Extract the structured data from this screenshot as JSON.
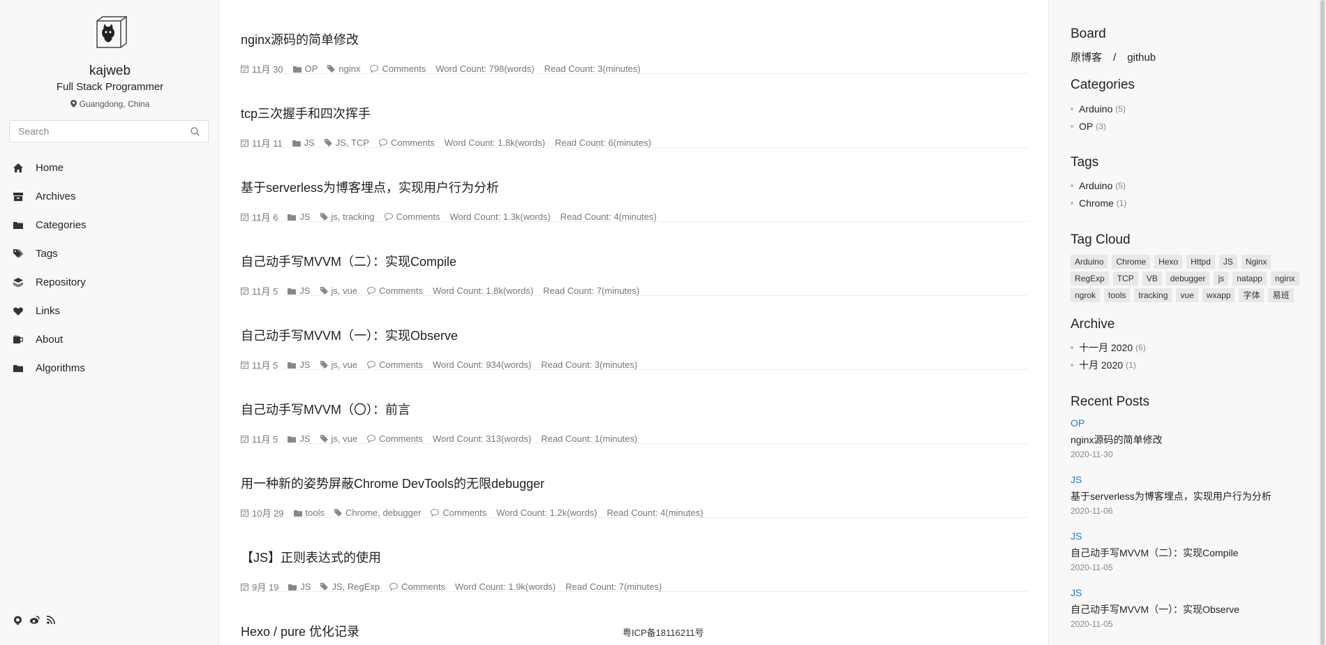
{
  "author": {
    "name": "kajweb",
    "subtitle": "Full Stack Programmer",
    "location": "Guangdong, China"
  },
  "search": {
    "placeholder": "Search"
  },
  "nav": [
    {
      "label": "Home",
      "icon": "home-icon"
    },
    {
      "label": "Archives",
      "icon": "archive-icon"
    },
    {
      "label": "Categories",
      "icon": "folder-icon"
    },
    {
      "label": "Tags",
      "icon": "tags-icon"
    },
    {
      "label": "Repository",
      "icon": "repository-icon"
    },
    {
      "label": "Links",
      "icon": "handshake-icon"
    },
    {
      "label": "About",
      "icon": "coffee-icon"
    },
    {
      "label": "Algorithms",
      "icon": "folder-icon"
    }
  ],
  "social": [
    "github-icon",
    "weibo-icon",
    "rss-icon"
  ],
  "posts": [
    {
      "title": "nginx源码的简单修改",
      "date": "11月 30",
      "category": "OP",
      "tags": "nginx",
      "comments": "Comments",
      "word_count": "Word Count: 798(words)",
      "read_count": "Read Count: 3(minutes)"
    },
    {
      "title": "tcp三次握手和四次挥手",
      "date": "11月 11",
      "category": "JS",
      "tags": "JS, TCP",
      "comments": "Comments",
      "word_count": "Word Count: 1.8k(words)",
      "read_count": "Read Count: 6(minutes)"
    },
    {
      "title": "基于serverless为博客埋点，实现用户行为分析",
      "date": "11月 6",
      "category": "JS",
      "tags": "js, tracking",
      "comments": "Comments",
      "word_count": "Word Count: 1.3k(words)",
      "read_count": "Read Count: 4(minutes)"
    },
    {
      "title": "自己动手写MVVM（二）：实现Compile",
      "date": "11月 5",
      "category": "JS",
      "tags": "js, vue",
      "comments": "Comments",
      "word_count": "Word Count: 1.8k(words)",
      "read_count": "Read Count: 7(minutes)"
    },
    {
      "title": "自己动手写MVVM（一）：实现Observe",
      "date": "11月 5",
      "category": "JS",
      "tags": "js, vue",
      "comments": "Comments",
      "word_count": "Word Count: 934(words)",
      "read_count": "Read Count: 3(minutes)"
    },
    {
      "title": "自己动手写MVVM（〇）：前言",
      "date": "11月 5",
      "category": "JS",
      "tags": "js, vue",
      "comments": "Comments",
      "word_count": "Word Count: 313(words)",
      "read_count": "Read Count: 1(minutes)"
    },
    {
      "title": "用一种新的姿势屏蔽Chrome DevTools的无限debugger",
      "date": "10月 29",
      "category": "tools",
      "tags": "Chrome, debugger",
      "comments": "Comments",
      "word_count": "Word Count: 1.2k(words)",
      "read_count": "Read Count: 4(minutes)"
    },
    {
      "title": "【JS】正则表达式的使用",
      "date": "9月 19",
      "category": "JS",
      "tags": "JS, RegExp",
      "comments": "Comments",
      "word_count": "Word Count: 1.9k(words)",
      "read_count": "Read Count: 7(minutes)"
    },
    {
      "title": "Hexo / pure 优化记录"
    }
  ],
  "icp": "粤ICP备18116211号",
  "board": {
    "title": "Board",
    "link1": "原博客",
    "separator": "/",
    "link2": "github"
  },
  "categories": {
    "title": "Categories",
    "items": [
      {
        "label": "Arduino",
        "count": "(5)"
      },
      {
        "label": "OP",
        "count": "(3)"
      }
    ]
  },
  "tags": {
    "title": "Tags",
    "items": [
      {
        "label": "Arduino",
        "count": "(5)"
      },
      {
        "label": "Chrome",
        "count": "(1)"
      }
    ]
  },
  "tag_cloud": {
    "title": "Tag Cloud",
    "items": [
      "Arduino",
      "Chrome",
      "Hexo",
      "Httpd",
      "JS",
      "Nginx",
      "RegExp",
      "TCP",
      "VB",
      "debugger",
      "js",
      "natapp",
      "nginx",
      "ngrok",
      "tools",
      "tracking",
      "vue",
      "wxapp",
      "字体",
      "易班"
    ]
  },
  "archive": {
    "title": "Archive",
    "items": [
      {
        "label": "十一月 2020",
        "count": "(6)"
      },
      {
        "label": "十月 2020",
        "count": "(1)"
      }
    ]
  },
  "recent_posts": {
    "title": "Recent Posts",
    "items": [
      {
        "category": "OP",
        "title": "nginx源码的简单修改",
        "date": "2020-11-30"
      },
      {
        "category": "JS",
        "title": "基于serverless为博客埋点，实现用户行为分析",
        "date": "2020-11-06"
      },
      {
        "category": "JS",
        "title": "自己动手写MVVM（二）：实现Compile",
        "date": "2020-11-05"
      },
      {
        "category": "JS",
        "title": "自己动手写MVVM（一）：实现Observe",
        "date": "2020-11-05"
      }
    ]
  },
  "colors": {
    "accent": "#2479cc",
    "sidebar_bg": "#f8f8f8",
    "tag_bg": "#e8e8e8"
  }
}
